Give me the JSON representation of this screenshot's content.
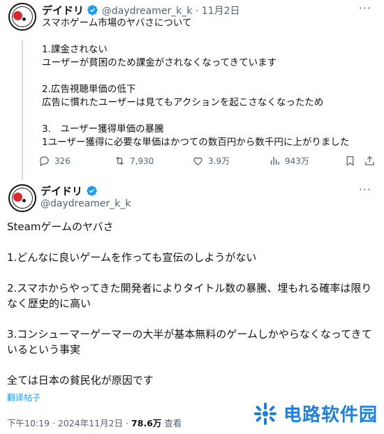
{
  "tweet1": {
    "display_name": "デイドリ",
    "handle": "@daydreamer_k_k",
    "separator": "·",
    "date": "11月2日",
    "more_label": "···",
    "text": "スマホゲーム市場のヤバさについて\n\n1.課金されない\nユーザーが貧困のため課金がされなくなってきています\n\n2.広告視聴単価の低下\n広告に慣れたユーザーは見てもアクションを起こさなくなったため\n\n3.　ユーザー獲得単価の暴騰\n1ユーザー獲得に必要な単価はかつての数百円から数千円に上がりました",
    "stats": {
      "replies": "326",
      "retweets": "7,930",
      "likes": "3.9万",
      "views": "943万"
    }
  },
  "tweet2": {
    "display_name": "デイドリ",
    "handle": "@daydreamer_k_k",
    "more_label": "···",
    "text": "Steamゲームのヤバさ\n\n1.どんなに良いゲームを作っても宣伝のしようがない\n\n2.スマホからやってきた開発者によりタイトル数の暴騰、埋もれる確率は限りなく歴史的に高い\n\n3.コンシューマーゲーマーの大半が基本無料のゲームしかやらなくなってきているという事実\n\n全ては日本の貧民化が原因です",
    "translate_label": "翻译帖子",
    "timestamp": "下午10:19 · 2024年11月2日 · ",
    "view_count": "78.6万",
    "view_label": " 查看"
  },
  "watermark": {
    "text": "电路软件园"
  },
  "colors": {
    "accent": "#1d9bf0",
    "verified": "#1d9bf0",
    "muted": "#536471",
    "avatar_red": "#d7282f",
    "watermark": "#1f7fd8"
  },
  "icons": [
    "reply-icon",
    "retweet-icon",
    "like-icon",
    "views-icon",
    "bookmark-icon",
    "share-icon",
    "verified-icon",
    "more-icon"
  ]
}
